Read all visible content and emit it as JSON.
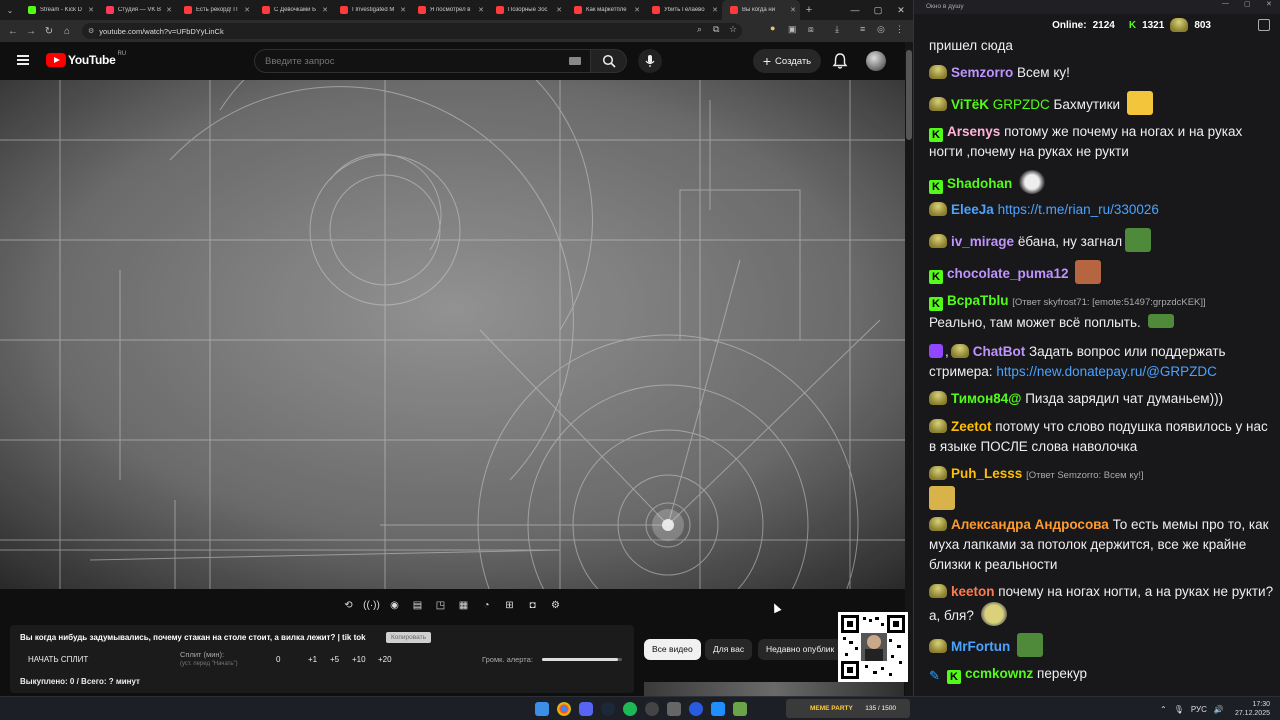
{
  "browser": {
    "tabs": [
      {
        "label": "Stream - Kick D",
        "color": "#53fc18"
      },
      {
        "label": "Студия — VK В",
        "color": "#ff3b5c"
      },
      {
        "label": "Есть рекорд! П",
        "color": "#ff3b3b"
      },
      {
        "label": "С Девочками Б",
        "color": "#ff3b3b"
      },
      {
        "label": "I Investigated M",
        "color": "#ff3b3b"
      },
      {
        "label": "Я посмотрел в",
        "color": "#ff3b3b"
      },
      {
        "label": "Позорные Зос",
        "color": "#ff3b3b"
      },
      {
        "label": "Как маркетпле",
        "color": "#ff3b3b"
      },
      {
        "label": "Убить Гелаево",
        "color": "#ff3b3b"
      },
      {
        "label": "Вы когда ни",
        "color": "#ff3b3b"
      }
    ],
    "url": "youtube.com/watch?v=UFbDYyLinCk"
  },
  "youtube": {
    "region": "RU",
    "search_placeholder": "Введите запрос",
    "create_label": "Создать"
  },
  "split": {
    "title": "Вы когда нибудь задумывались, почему стакан на столе стоит, а вилка лежит? | tik tok",
    "copy_label": "Копировать",
    "start_label": "НАЧАТЬ СПЛИТ",
    "split_label": "Сплит (мин):",
    "split_hint": "(уст. перед \"Начать\")",
    "values": [
      "0",
      "+1",
      "+5",
      "+10",
      "+20"
    ],
    "alert_label": "Громк. алерта:",
    "alert_level": 0.95,
    "done_line": "Выкуплено: 0 / Всего: ? минут"
  },
  "chips": {
    "all": "Все видео",
    "for_you": "Для вас",
    "recent": "Недавно опублик"
  },
  "chat": {
    "window_title": "Окно в душу",
    "online_label": "Online:",
    "online": "2124",
    "kicks": "1321",
    "points": "803",
    "messages": [
      {
        "text": "пришел сюда"
      },
      {
        "user": "Semzorro",
        "color": "#bf94ff",
        "badge": "pepe",
        "text": "Всем ку!"
      },
      {
        "user": "ViTёK",
        "user2": "GRPZDC",
        "color": "#53fc18",
        "badge": "pepe",
        "text": "Бахмутики"
      },
      {
        "user": "Arsenys",
        "color": "#ffb3d9",
        "badge": "kick",
        "text": "потому же почему на ногах и на руках ногти ,почему на руках не рукти"
      },
      {
        "user": "Shadohan",
        "color": "#53fc18",
        "badge": "kick",
        "text": ""
      },
      {
        "user": "EleeJa",
        "color": "#4aa3ff",
        "badge": "pepe",
        "text": "https://t.me/rian_ru/330026"
      },
      {
        "user": "iv_mirage",
        "color": "#bf94ff",
        "badge": "pepe",
        "text": "ёбана, ну загнал"
      },
      {
        "user": "chocolate_puma12",
        "color": "#bf94ff",
        "badge": "kick",
        "text": ""
      },
      {
        "user": "BcpaTblu",
        "color": "#53fc18",
        "badge": "kick",
        "reply": "[Ответ skyfrost71: [emote:51497:grpzdcKEK]]",
        "text": "Реально, там может всё поплыть."
      },
      {
        "user": "ChatBot",
        "color": "#bf94ff",
        "badge": "bot",
        "text": "Задать вопрос или поддержать стримера:",
        "link": "https://new.donatepay.ru/@GRPZDC"
      },
      {
        "user": "Тимон84@",
        "color": "#53fc18",
        "badge": "pepe",
        "text": "Пизда зарядил чат думаньем)))"
      },
      {
        "user": "Zeetot",
        "color": "#ffbf00",
        "badge": "pepe",
        "text": "потому что слово подушка появилось у нас в языке ПОСЛЕ слова наволочка"
      },
      {
        "user": "Puh_Lesss",
        "color": "#ffbf00",
        "badge": "pepe",
        "reply": "[Ответ Semzorro: Всем ку!]",
        "text": ""
      },
      {
        "user": "Александра Андросова",
        "color": "#ff9b2e",
        "badge": "pepe",
        "text": "То есть мемы про то, как муха лапками за потолок держится, все же крайне близки к реальности"
      },
      {
        "user": "keeton",
        "color": "#ff7a4d",
        "badge": "pepe",
        "text": "почему на ногах ногти, а на руках не рукти? а, бля?"
      },
      {
        "user": "MrFortun",
        "color": "#4aa3ff",
        "badge": "pepe",
        "text": ""
      },
      {
        "user": "ccmkownz",
        "color": "#53fc18",
        "badge": "mod",
        "text": "перекур"
      }
    ]
  },
  "taskbar": {
    "meme_title": "MEME PARTY",
    "meme_counter": "135 / 1500",
    "lang": "РУС",
    "time": "17:30",
    "date": "27.12.2025"
  }
}
